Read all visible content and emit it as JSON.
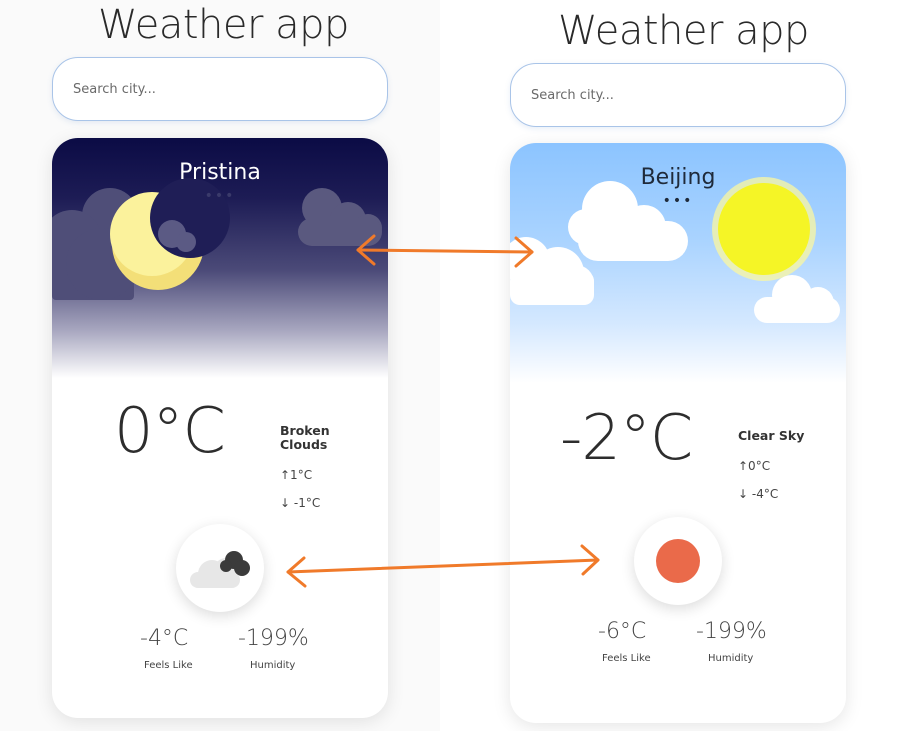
{
  "left": {
    "app_title": "Weather app",
    "search_placeholder": "Search city...",
    "city": "Pristina",
    "loading_dots": "•••",
    "temperature": "0°C",
    "description": "Broken Clouds",
    "temp_max": "↑1°C",
    "temp_min": "↓ -1°C",
    "feels_like_value": "-4°C",
    "feels_like_label": "Feels Like",
    "humidity_value": "-199%",
    "humidity_label": "Humidity",
    "condition_icon": "broken-clouds-icon",
    "scene_icon": "moon-icon"
  },
  "right": {
    "app_title": "Weather app",
    "search_placeholder": "Search city...",
    "city": "Beijing",
    "loading_dots": "•••",
    "temperature": "-2°C",
    "description": "Clear Sky",
    "temp_max": "↑0°C",
    "temp_min": "↓ -4°C",
    "feels_like_value": "-6°C",
    "feels_like_label": "Feels Like",
    "humidity_value": "-199%",
    "humidity_label": "Humidity",
    "condition_icon": "sun-icon",
    "scene_icon": "sun-icon"
  },
  "colors": {
    "arrow": "#f07a2a",
    "night_sky": "#0b0b45",
    "day_sky": "#8cc4ff",
    "moon": "#f8ec8c",
    "sun": "#f5f526",
    "clear_icon": "#ea6a4a"
  }
}
